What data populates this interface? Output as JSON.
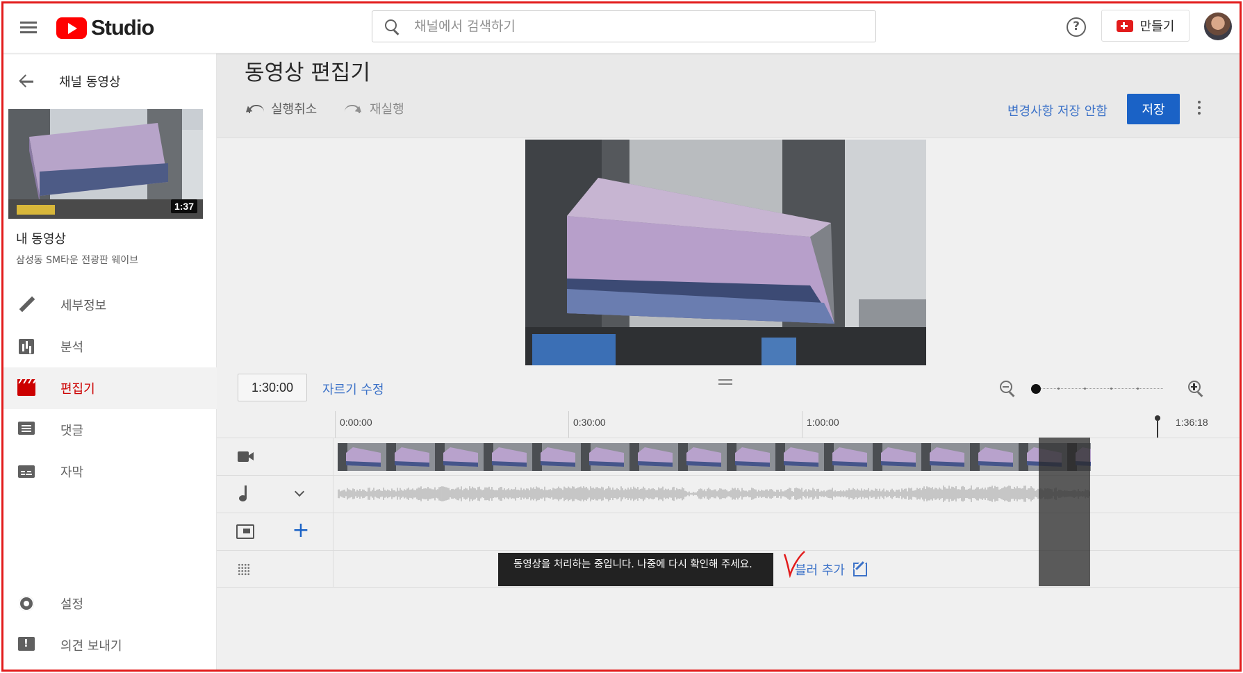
{
  "header": {
    "logo_text": "Studio",
    "search_placeholder": "채널에서 검색하기",
    "help_label": "?",
    "create_label": "만들기"
  },
  "sidebar": {
    "back_label": "채널 동영상",
    "thumbnail_duration": "1:37",
    "video_title": "내 동영상",
    "video_subtitle": "삼성동 SM타운 전광판 웨이브",
    "items": [
      {
        "label": "세부정보",
        "icon": "pencil-icon",
        "active": false
      },
      {
        "label": "분석",
        "icon": "analytics-icon",
        "active": false
      },
      {
        "label": "편집기",
        "icon": "editor-icon",
        "active": true
      },
      {
        "label": "댓글",
        "icon": "comments-icon",
        "active": false
      },
      {
        "label": "자막",
        "icon": "subtitles-icon",
        "active": false
      }
    ],
    "bottom_items": [
      {
        "label": "설정",
        "icon": "gear-icon"
      },
      {
        "label": "의견 보내기",
        "icon": "feedback-icon"
      }
    ]
  },
  "editor": {
    "title": "동영상 편집기",
    "undo_label": "실행취소",
    "redo_label": "재실행",
    "discard_label": "변경사항 저장 안함",
    "save_label": "저장"
  },
  "timeline": {
    "current_time": "1:30:00",
    "trim_label": "자르기 수정",
    "ruler_ticks": [
      "0:00:00",
      "0:30:00",
      "1:00:00"
    ],
    "playhead_time": "1:36:18",
    "blur_label": "블러 추가"
  },
  "toast": {
    "message": "동영상을 처리하는 중입니다. 나중에 다시 확인해 주세요."
  },
  "colors": {
    "brand_red": "#ff0000",
    "accent_blue": "#1a62c6",
    "link_blue": "#3c72c8",
    "active_red": "#cc0000"
  }
}
